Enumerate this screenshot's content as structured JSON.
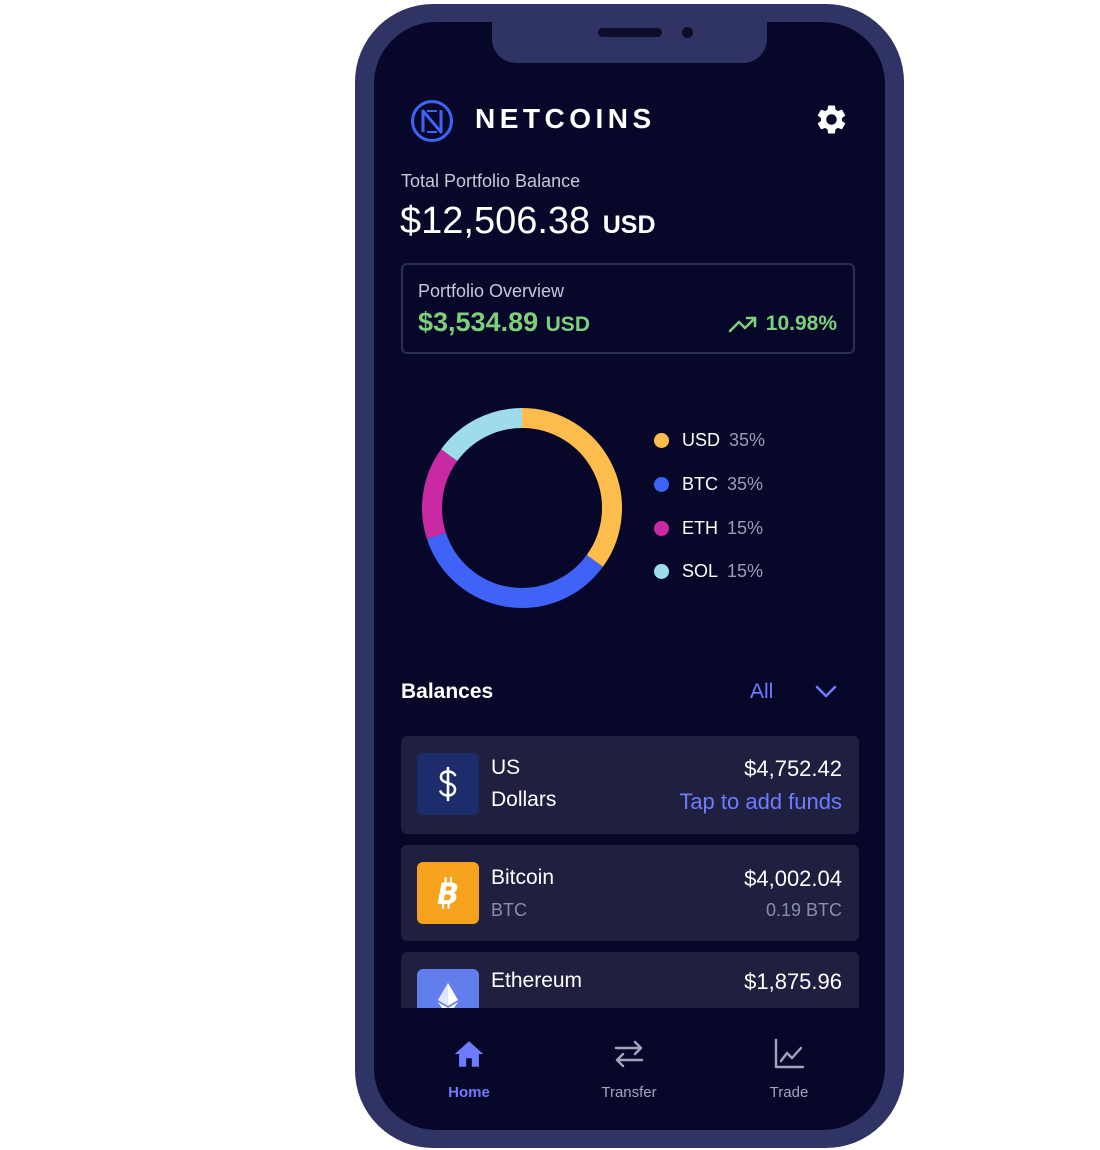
{
  "header": {
    "brand": "NETCOINS",
    "settings_icon": "gear-icon",
    "logo_icon": "netcoins-logo-icon"
  },
  "portfolio": {
    "label": "Total Portfolio Balance",
    "balance": "$12,506.38",
    "currency": "USD"
  },
  "overview": {
    "label": "Portfolio Overview",
    "amount": "$3,534.89",
    "currency": "USD",
    "change": "10.98%",
    "change_icon": "trending-up-icon"
  },
  "allocation": {
    "items": [
      {
        "name": "USD",
        "percent": "35%",
        "color": "#fdbd4c"
      },
      {
        "name": "BTC",
        "percent": "35%",
        "color": "#3e63f6"
      },
      {
        "name": "ETH",
        "percent": "15%",
        "color": "#c92aa3"
      },
      {
        "name": "SOL",
        "percent": "15%",
        "color": "#9fdcea"
      }
    ]
  },
  "balances": {
    "title": "Balances",
    "filter": "All",
    "rows": [
      {
        "name_line1": "US",
        "name_line2": "Dollars",
        "amount": "$4,752.42",
        "action": "Tap to add funds",
        "icon": "dollar-icon",
        "icon_bg": "#1d2d6b"
      },
      {
        "name": "Bitcoin",
        "symbol": "BTC",
        "amount": "$4,002.04",
        "holding": "0.19 BTC",
        "icon": "bitcoin-icon",
        "icon_bg": "#f6a21c"
      },
      {
        "name": "Ethereum",
        "amount": "$1,875.96",
        "icon": "ethereum-icon",
        "icon_bg": "#627eea"
      }
    ]
  },
  "tabs": [
    {
      "label": "Home",
      "icon": "home-icon",
      "active": true
    },
    {
      "label": "Transfer",
      "icon": "transfer-icon",
      "active": false
    },
    {
      "label": "Trade",
      "icon": "trade-chart-icon",
      "active": false
    }
  ],
  "colors": {
    "background": "#070829",
    "frame": "#2f3465",
    "accent": "#6e7bff",
    "positive": "#7dd07a",
    "card": "#1f2040"
  }
}
